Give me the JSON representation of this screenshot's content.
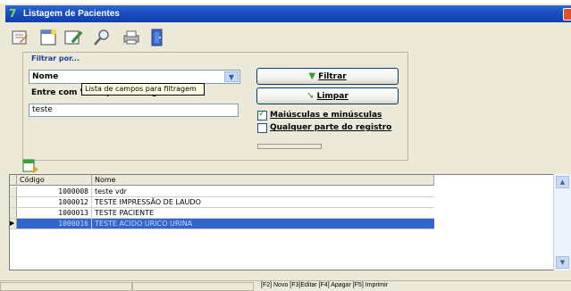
{
  "window": {
    "title": "Listagem de Pacientes"
  },
  "toolbar": {
    "buttons": [
      {
        "icon": "edit-record-icon"
      },
      {
        "icon": "new-record-icon"
      },
      {
        "icon": "edit-pencil-icon"
      },
      {
        "icon": "search-magnifier-icon"
      },
      {
        "icon": "printer-icon"
      },
      {
        "icon": "exit-door-icon"
      }
    ]
  },
  "filter": {
    "group_label": "Filtrar por...",
    "field_selected": "Nome",
    "tooltip": "Lista de campos para filtragem",
    "value_label": "Entre com Valor para filtragem",
    "value": "teste",
    "filter_button": "Filtrar",
    "clear_button": "Limpar",
    "case_checkbox_label": "Maiúsculas e minúsculas",
    "case_checked": true,
    "partial_checkbox_label": "Qualquer parte do registro",
    "partial_checked": false
  },
  "grid": {
    "columns": [
      "Código",
      "Nome"
    ],
    "rows": [
      {
        "code": "1000008",
        "name": "teste vdr"
      },
      {
        "code": "1000012",
        "name": "TESTE IMPRESSÃO DE LAUDO"
      },
      {
        "code": "1000013",
        "name": "TESTE PACIENTE"
      },
      {
        "code": "1000016",
        "name": "TESTE ACIDO URICO URINA",
        "selected": true
      }
    ]
  },
  "statusbar": {
    "text": "[F2] Novo [F3]Editar [F4] Apagar [F5] Imprimir"
  },
  "colors": {
    "titlebar": "#1b4fc1",
    "selection": "#3366cc",
    "window_bg": "#ece9d8"
  }
}
